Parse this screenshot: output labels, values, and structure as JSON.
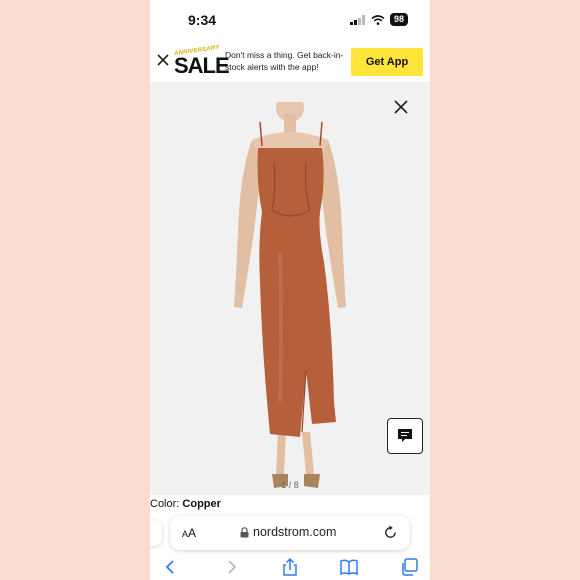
{
  "status_bar": {
    "time": "9:34",
    "battery": "98"
  },
  "banner": {
    "sale_tagline": "ANNIVERSARY",
    "sale_word": "SALE",
    "message": "Don't miss a thing. Get back-in-stock alerts with the app!",
    "cta_label": "Get App"
  },
  "product": {
    "image_counter": "1 / 8",
    "color_label": "Color:",
    "color_value": "Copper",
    "dress_color": "#b5603b"
  },
  "browser": {
    "aa_label": "AA",
    "url": "nordstrom.com"
  },
  "colors": {
    "banner_button": "#ffe43a",
    "accent_ios": "#2f7cf6"
  }
}
